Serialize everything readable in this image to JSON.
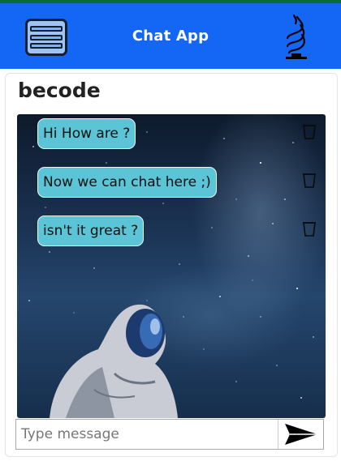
{
  "app": {
    "title": "Chat App",
    "header_color": "#1466f5",
    "accent_strip_color": "#0b6b3a"
  },
  "header": {
    "menu_icon": "hamburger-menu-icon",
    "logo_icon": "stacked-layers-logo-icon"
  },
  "room": {
    "name": "becode"
  },
  "messages": [
    {
      "text": "Hi How are ?",
      "delete_icon": "trash-icon"
    },
    {
      "text": "Now we can chat here ;)",
      "delete_icon": "trash-icon"
    },
    {
      "text": "isn't it great ?",
      "delete_icon": "trash-icon"
    }
  ],
  "bubble_color": "#5bc4d6",
  "composer": {
    "placeholder": "Type message",
    "value": "",
    "send_icon": "send-arrow-icon"
  }
}
